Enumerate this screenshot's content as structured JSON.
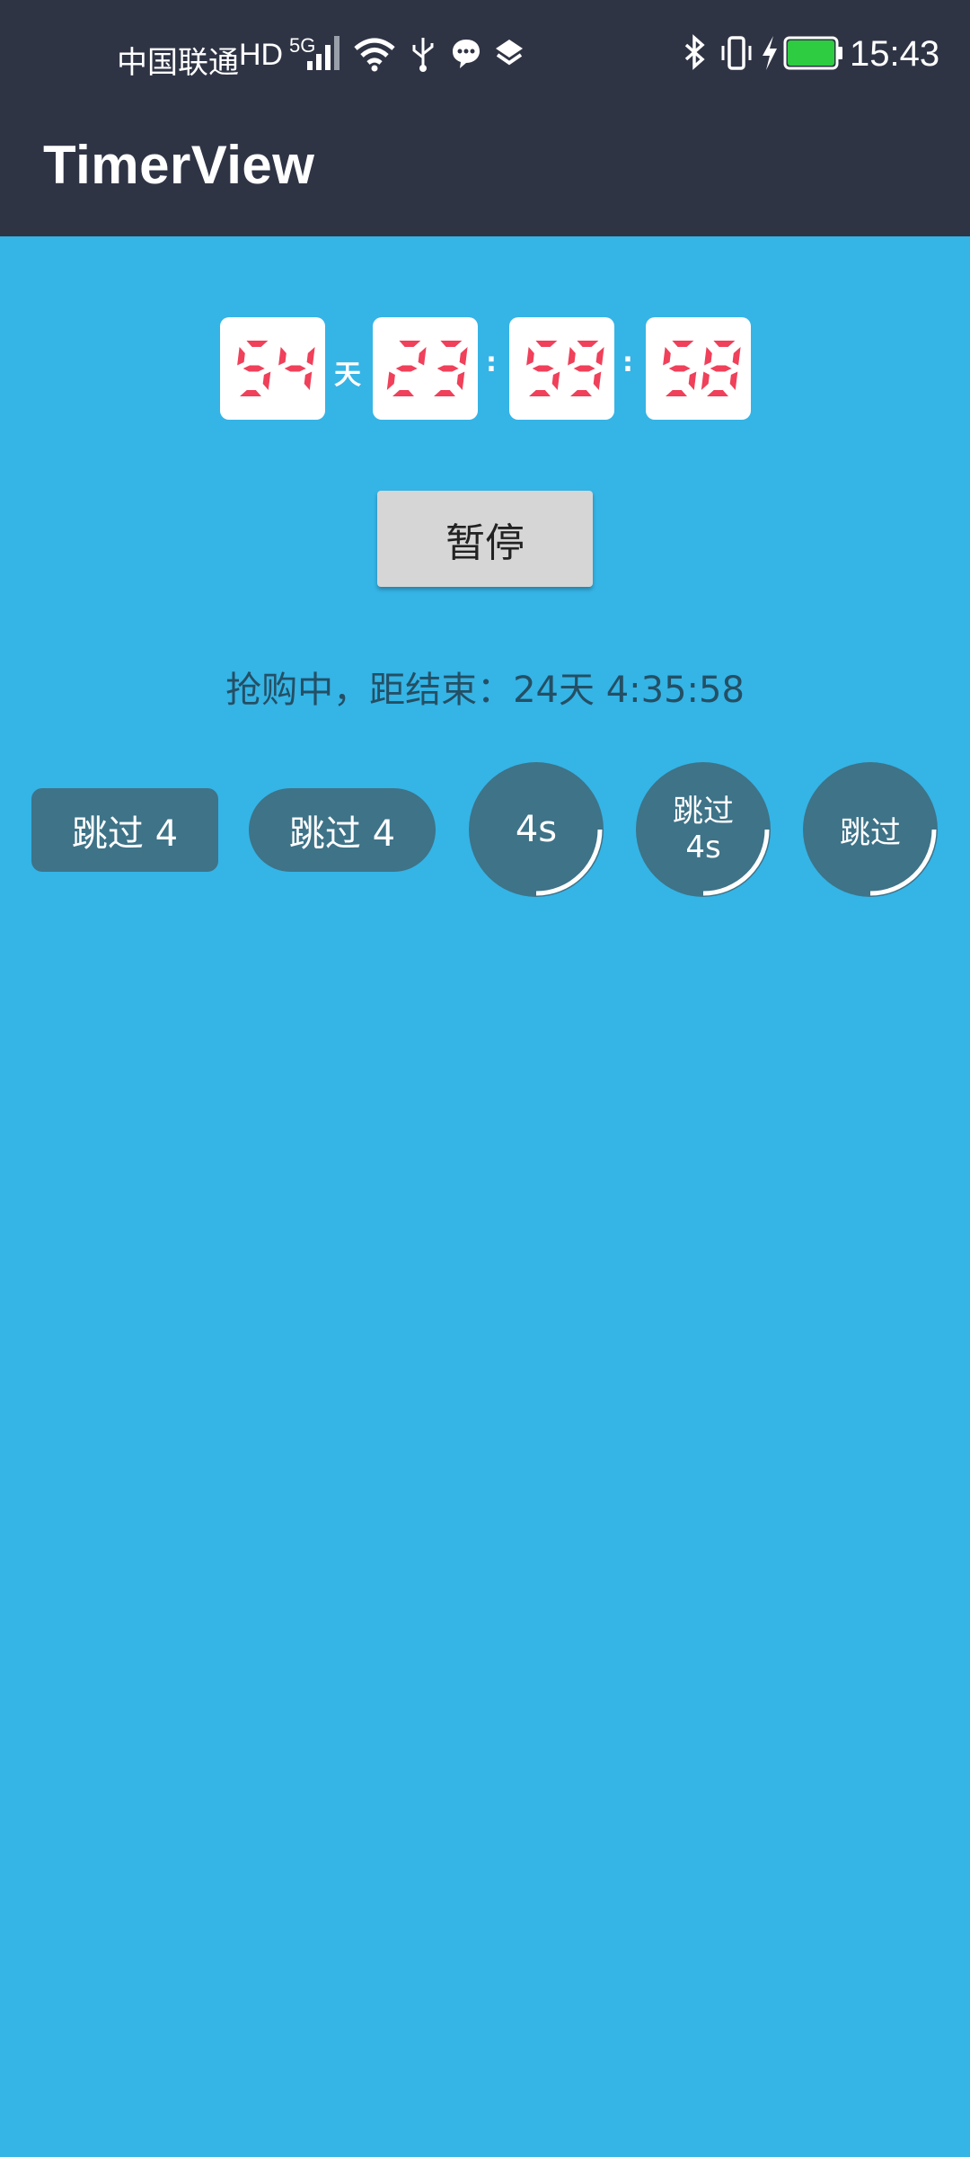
{
  "status_bar": {
    "carrier": "中国联通",
    "hd": "HD",
    "network": "5G",
    "time": "15:43",
    "battery_color": "#2ecc40"
  },
  "app_bar": {
    "title": "TimerView"
  },
  "timer": {
    "days": "54",
    "day_unit": "天",
    "hours": "23",
    "sep1": ":",
    "minutes": "59",
    "sep2": ":",
    "seconds": "58",
    "digit_color": "#f0405a"
  },
  "pause_button": {
    "label": "暂停"
  },
  "countdown_text": "抢购中，距结束：24天 4:35:58",
  "skip_buttons": [
    {
      "label": "跳过 4"
    },
    {
      "label": "跳过 4"
    },
    {
      "label": "4s"
    },
    {
      "line1": "跳过",
      "line2": "4s"
    },
    {
      "label": "跳过"
    }
  ],
  "colors": {
    "background": "#35b4e6",
    "app_bar": "#2f3445",
    "skip_button": "#3e7388",
    "progress_ring": "#ffffff"
  }
}
